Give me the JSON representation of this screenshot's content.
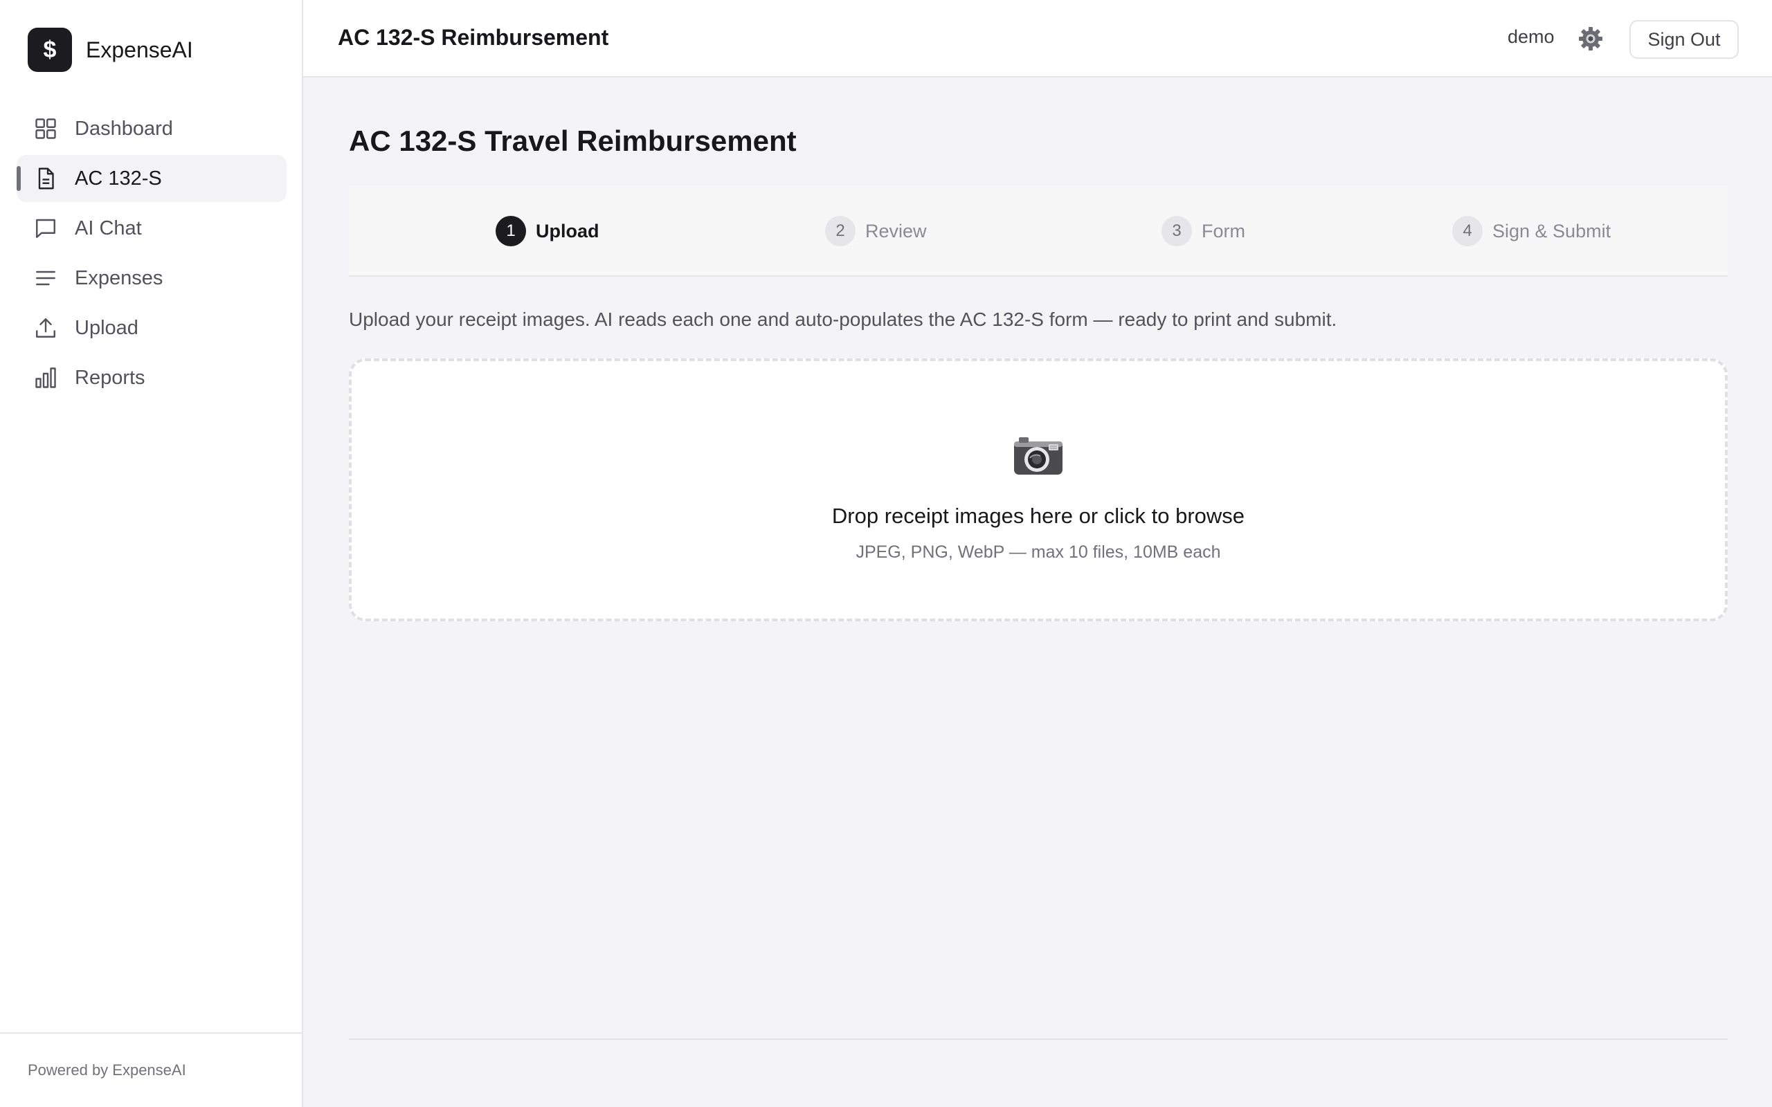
{
  "brand": {
    "logo_symbol": "$",
    "name": "ExpenseAI"
  },
  "sidebar": {
    "items": [
      {
        "label": "Dashboard",
        "icon": "grid-icon"
      },
      {
        "label": "AC 132-S",
        "icon": "document-icon",
        "active": true
      },
      {
        "label": "AI Chat",
        "icon": "chat-icon"
      },
      {
        "label": "Expenses",
        "icon": "list-icon"
      },
      {
        "label": "Upload",
        "icon": "upload-icon"
      },
      {
        "label": "Reports",
        "icon": "bar-chart-icon"
      }
    ],
    "footer": "Powered by ExpenseAI"
  },
  "header": {
    "title": "AC 132-S Reimbursement",
    "user": "demo",
    "settings_icon": "gear-icon",
    "sign_out": "Sign Out"
  },
  "main": {
    "title": "AC 132-S Travel Reimbursement",
    "steps": [
      {
        "num": "1",
        "label": "Upload",
        "active": true
      },
      {
        "num": "2",
        "label": "Review"
      },
      {
        "num": "3",
        "label": "Form"
      },
      {
        "num": "4",
        "label": "Sign & Submit"
      }
    ],
    "intro": "Upload your receipt images. AI reads each one and auto-populates the AC 132-S form — ready to print and submit.",
    "dropzone": {
      "icon": "camera-icon",
      "title": "Drop receipt images here or click to browse",
      "subtitle": "JPEG, PNG, WebP — max 10 files, 10MB each"
    }
  },
  "colors": {
    "accent": "#1c1c1f",
    "background": "#f4f4f6",
    "muted_text": "#71717a"
  }
}
